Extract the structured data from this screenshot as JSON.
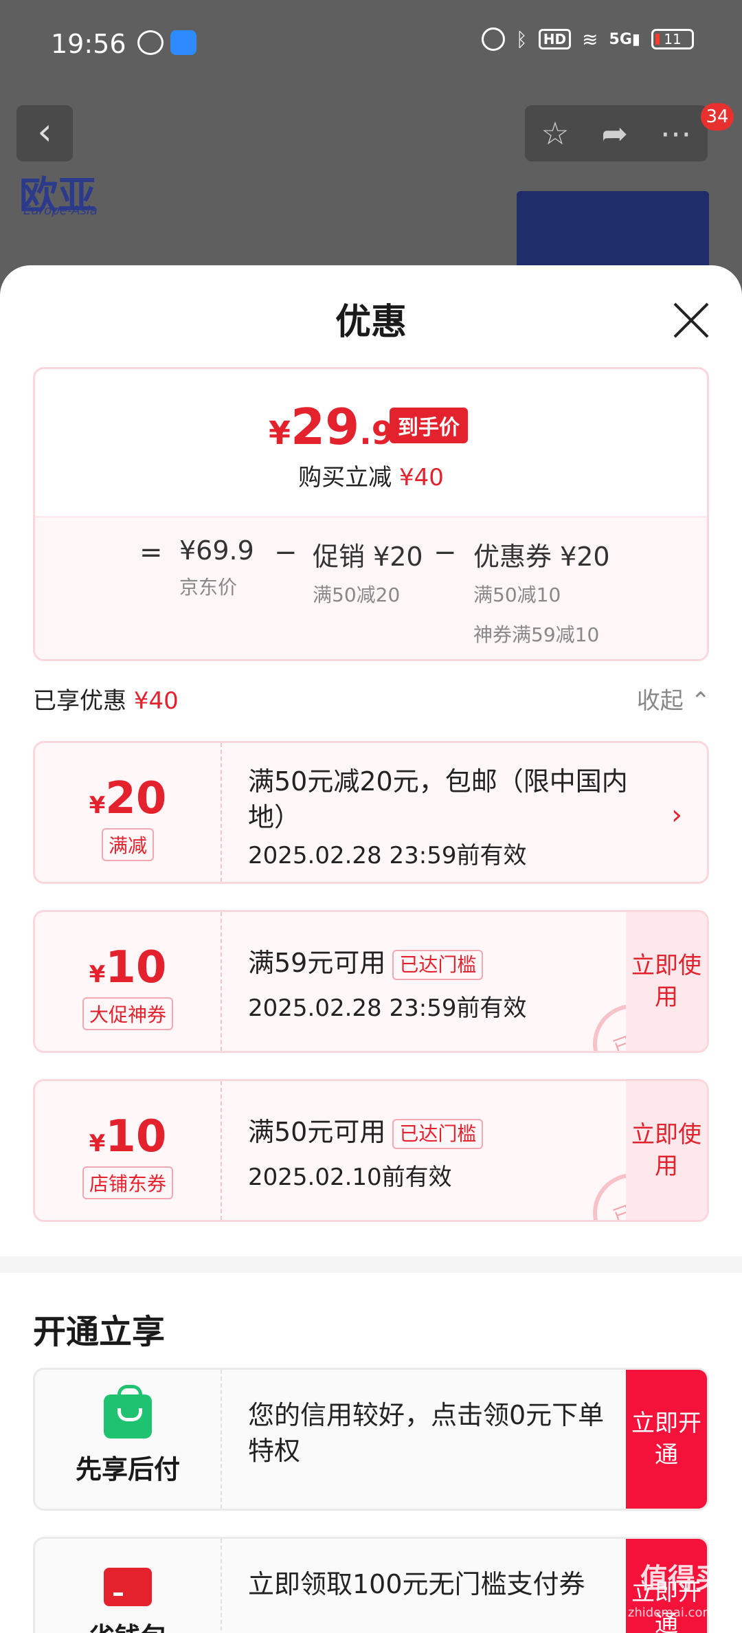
{
  "status_bar": {
    "time": "19:56",
    "hd": "HD",
    "network": "5G",
    "battery": "11"
  },
  "header": {
    "cart_badge": "34"
  },
  "background": {
    "brand": "欧亚",
    "brand_sub": "Europe-Asia"
  },
  "sheet": {
    "title": "优惠",
    "price": {
      "currency": "¥",
      "int": "29",
      "dec": ".9",
      "tag": "到手价",
      "reduce_label": "购买立减",
      "reduce_amount": "¥40"
    },
    "breakdown": {
      "eq": "=",
      "minus": "−",
      "jd_price": "¥69.9",
      "jd_price_label": "京东价",
      "promo": "促销 ¥20",
      "promo_sub": "满50减20",
      "coupon": "优惠券 ¥20",
      "coupon_sub1": "满50减10",
      "coupon_sub2": "神券满59减10"
    },
    "enjoyed_label": "已享优惠",
    "enjoyed_amount": "¥40",
    "collapse_label": "收起 ⌃",
    "coupons": [
      {
        "y": "¥",
        "amount": "20",
        "tag": "满减",
        "desc": "满50元减20元，包邮（限中国内地）",
        "date": "2025.02.28 23:59前有效"
      },
      {
        "y": "¥",
        "amount": "10",
        "tag": "大促神券",
        "desc": "满59元可用",
        "reached": "已达门槛",
        "date": "2025.02.28 23:59前有效",
        "btn": "立即使用",
        "stamp": "已领"
      },
      {
        "y": "¥",
        "amount": "10",
        "tag": "店铺东券",
        "desc": "满50元可用",
        "reached": "已达门槛",
        "date": "2025.02.10前有效",
        "btn": "立即使用",
        "stamp": "已领"
      }
    ],
    "open_section_title": "开通立享",
    "open_items": [
      {
        "name": "先享后付",
        "desc": "您的信用较好，点击领0元下单特权",
        "btn": "立即开通"
      },
      {
        "name": "省钱包",
        "desc": "立即领取100元无门槛支付券",
        "btn": "立即开通"
      }
    ]
  },
  "watermark": {
    "text": "值得买",
    "sub": "zhidemai.com"
  }
}
